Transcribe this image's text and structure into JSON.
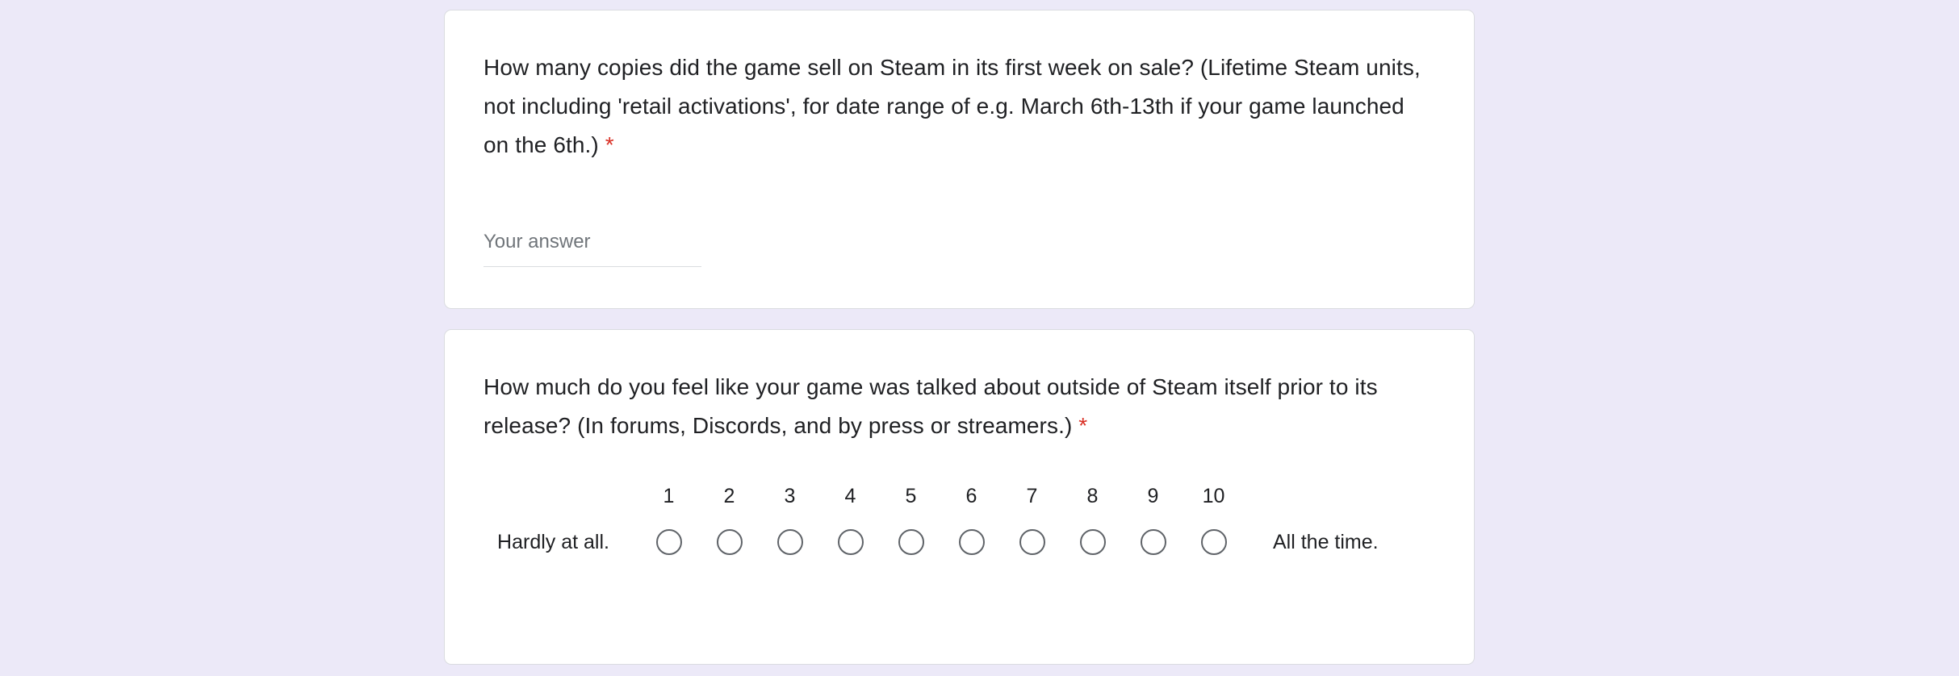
{
  "page": {
    "background_color": "#ece9f8",
    "card_background": "#ffffff",
    "card_border_color": "#dadce0",
    "required_marker_color": "#d93025",
    "text_color": "#202124",
    "placeholder_color": "#70757a",
    "radio_outline_color": "#5f6368"
  },
  "questions": [
    {
      "id": "q-steam-first-week-sales",
      "type": "short-answer",
      "title": "How many copies did the game sell on Steam in its first week on sale? (Lifetime Steam units, not including 'retail activations', for date range of e.g. March 6th-13th if your game launched on the 6th.)",
      "required": true,
      "required_marker": "*",
      "answer": {
        "placeholder": "Your answer",
        "value": ""
      }
    },
    {
      "id": "q-talked-about-outside-steam",
      "type": "linear-scale",
      "title": "How much do you feel like your game was talked about outside of Steam itself prior to its release? (In forums, Discords, and by press or streamers.)",
      "required": true,
      "required_marker": "*",
      "scale": {
        "labels": [
          "1",
          "2",
          "3",
          "4",
          "5",
          "6",
          "7",
          "8",
          "9",
          "10"
        ],
        "low_label": "Hardly at all.",
        "high_label": "All the time.",
        "selected": null
      }
    }
  ]
}
